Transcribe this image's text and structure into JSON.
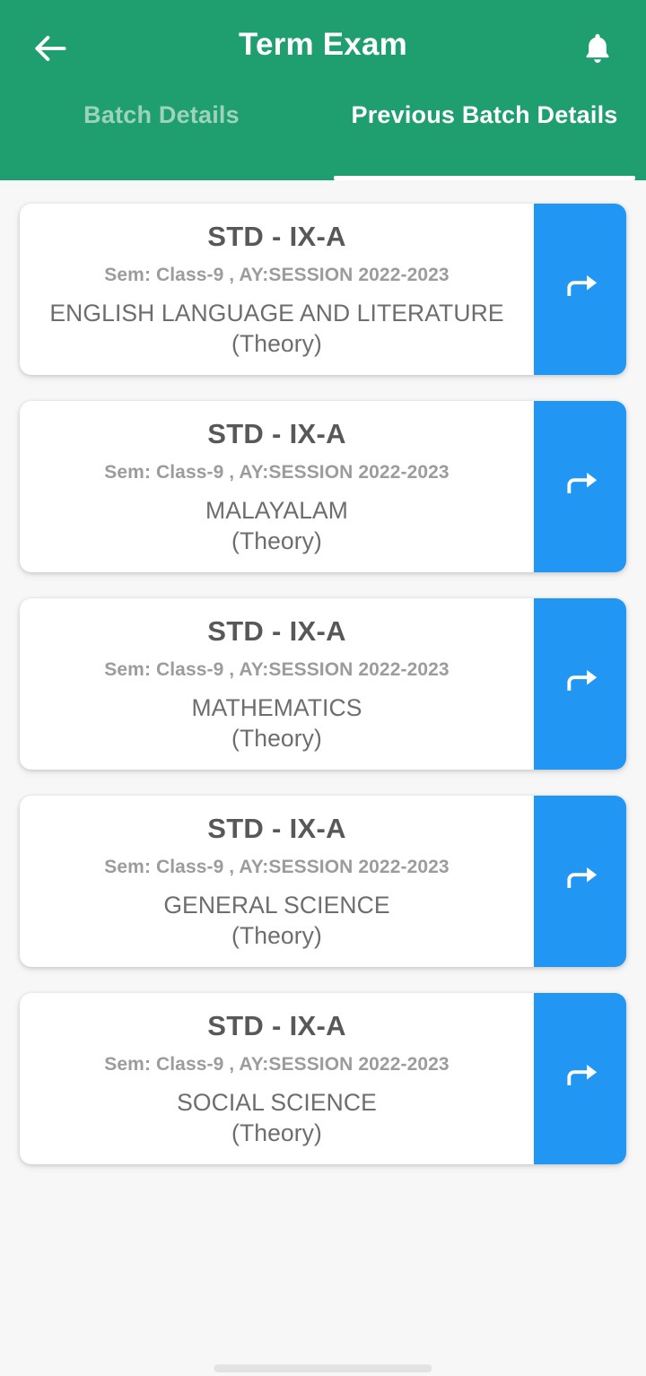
{
  "appbar": {
    "title": "Term Exam",
    "back_icon": "arrow-left-icon",
    "notification_icon": "bell-icon",
    "background_color": "#1f9e70"
  },
  "tabs": [
    {
      "label": "Batch Details",
      "active": false
    },
    {
      "label": "Previous Batch Details",
      "active": true
    }
  ],
  "list": {
    "accent_color": "#2196f3",
    "action_icon": "forward-arrow-icon",
    "cards": [
      {
        "std": "STD - IX-A",
        "sem": "Sem: Class-9 , AY:SESSION 2022-2023",
        "subject": "ENGLISH LANGUAGE AND LITERATURE",
        "type": "(Theory)"
      },
      {
        "std": "STD - IX-A",
        "sem": "Sem: Class-9 , AY:SESSION 2022-2023",
        "subject": "MALAYALAM",
        "type": "(Theory)"
      },
      {
        "std": "STD - IX-A",
        "sem": "Sem: Class-9 , AY:SESSION 2022-2023",
        "subject": "MATHEMATICS",
        "type": "(Theory)"
      },
      {
        "std": "STD - IX-A",
        "sem": "Sem: Class-9 , AY:SESSION 2022-2023",
        "subject": "GENERAL SCIENCE",
        "type": "(Theory)"
      },
      {
        "std": "STD - IX-A",
        "sem": "Sem: Class-9 , AY:SESSION 2022-2023",
        "subject": "SOCIAL SCIENCE",
        "type": "(Theory)"
      }
    ]
  },
  "system": {
    "home_indicator": "home-gesture-bar"
  }
}
